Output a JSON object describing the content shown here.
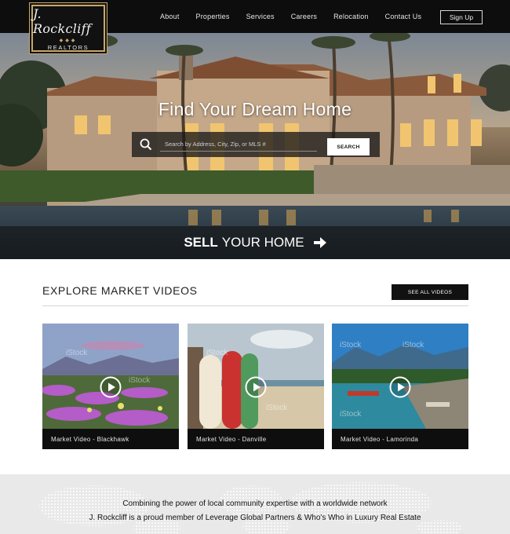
{
  "header": {
    "logo": {
      "script": "J. Rockcliff",
      "sub": "REALTORS"
    },
    "nav": [
      "About",
      "Properties",
      "Services",
      "Careers",
      "Relocation",
      "Contact Us"
    ],
    "signup_label": "Sign Up"
  },
  "hero": {
    "title": "Find Your Dream Home",
    "search": {
      "placeholder": "Search by Address, City, Zip, or MLS #",
      "button": "SEARCH"
    },
    "sell": {
      "bold": "SELL",
      "rest": "YOUR HOME"
    }
  },
  "videos": {
    "title": "EXPLORE MARKET VIDEOS",
    "see_all": "SEE ALL VIDEOS",
    "items": [
      {
        "caption": "Market Video - Blackhawk"
      },
      {
        "caption": "Market Video - Danville"
      },
      {
        "caption": "Market Video - Lamorinda"
      }
    ],
    "watermark": "iStock"
  },
  "network": {
    "line1": "Combining the power of local community expertise with a worldwide network",
    "line2": "J. Rockcliff is a proud member of Leverage Global Partners & Who's Who in Luxury Real Estate"
  },
  "colors": {
    "accent_gold": "#c7a86b",
    "header_bg": "#0d0d0d",
    "button_dark": "#111111"
  }
}
